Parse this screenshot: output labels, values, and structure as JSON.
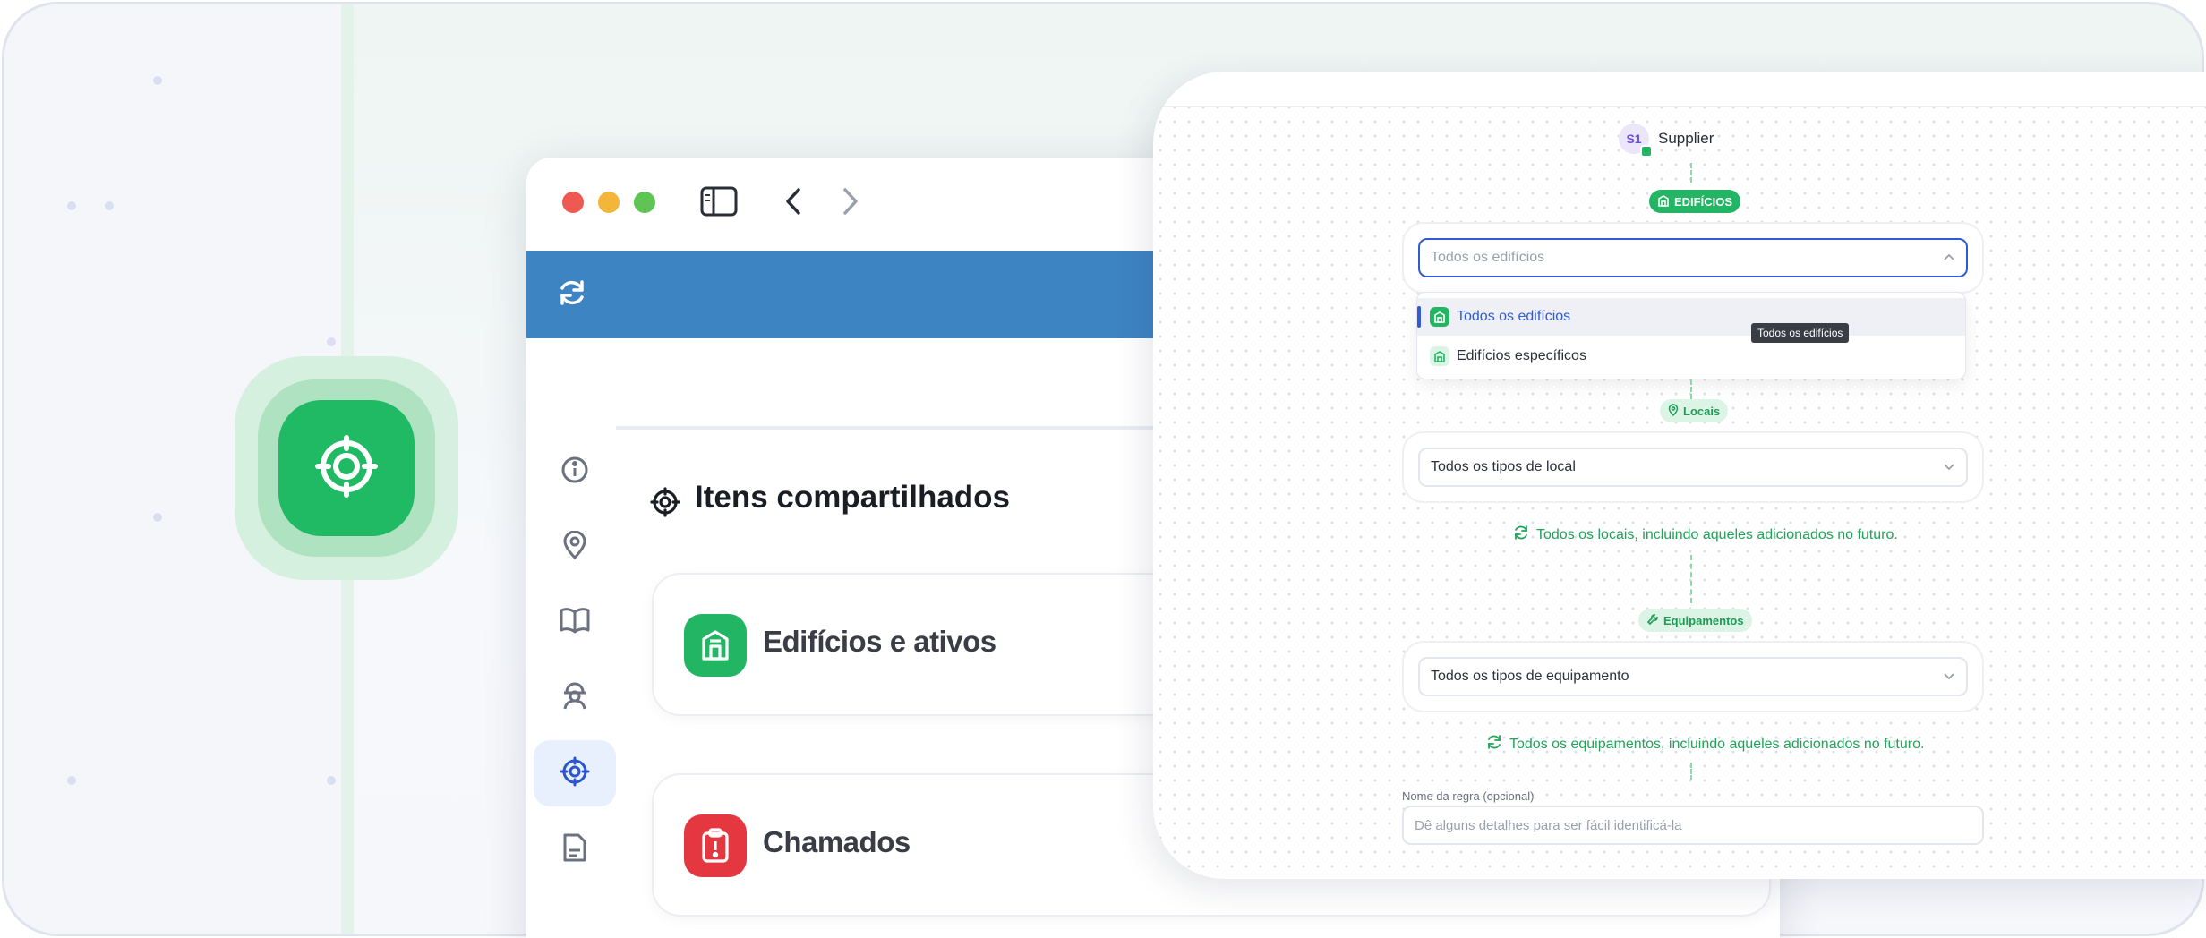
{
  "sharing_badge_icon": "shared-target-icon",
  "browser": {
    "refresh_icon": "refresh-icon",
    "sidebar_items": [
      "info-icon",
      "location-pin-icon",
      "book-icon",
      "technician-icon",
      "shared-target-icon",
      "report-icon"
    ],
    "section_title": "Itens compartilhados",
    "cards": [
      {
        "title": "Edifícios e ativos",
        "icon": "building-icon",
        "color": "#22b563"
      },
      {
        "title": "Chamados",
        "icon": "clipboard-alert-icon",
        "color": "#e5373f"
      }
    ]
  },
  "rules_panel": {
    "supplier": {
      "initials": "S1",
      "name": "Supplier"
    },
    "buildings": {
      "tag": "EDIFÍCIOS",
      "select_placeholder": "Todos os edifícios",
      "options": [
        "Todos os edifícios",
        "Edifícios específicos"
      ],
      "tooltip": "Todos os edifícios"
    },
    "locations": {
      "tag": "Locais",
      "select_value": "Todos os tipos de local",
      "info": "Todos os locais, incluindo aqueles adicionados no futuro."
    },
    "equipment": {
      "tag": "Equipamentos",
      "select_value": "Todos os tipos de equipamento",
      "info": "Todos os equipamentos, incluindo aqueles adicionados no futuro."
    },
    "rule_name": {
      "label": "Nome da regra (opcional)",
      "placeholder": "Dê alguns detalhes para ser fácil identificá-la"
    }
  },
  "colors": {
    "accent_green": "#22b563",
    "primary_blue": "#3d84c3",
    "focus_blue": "#2f5bd6",
    "danger_red": "#e5373f"
  }
}
